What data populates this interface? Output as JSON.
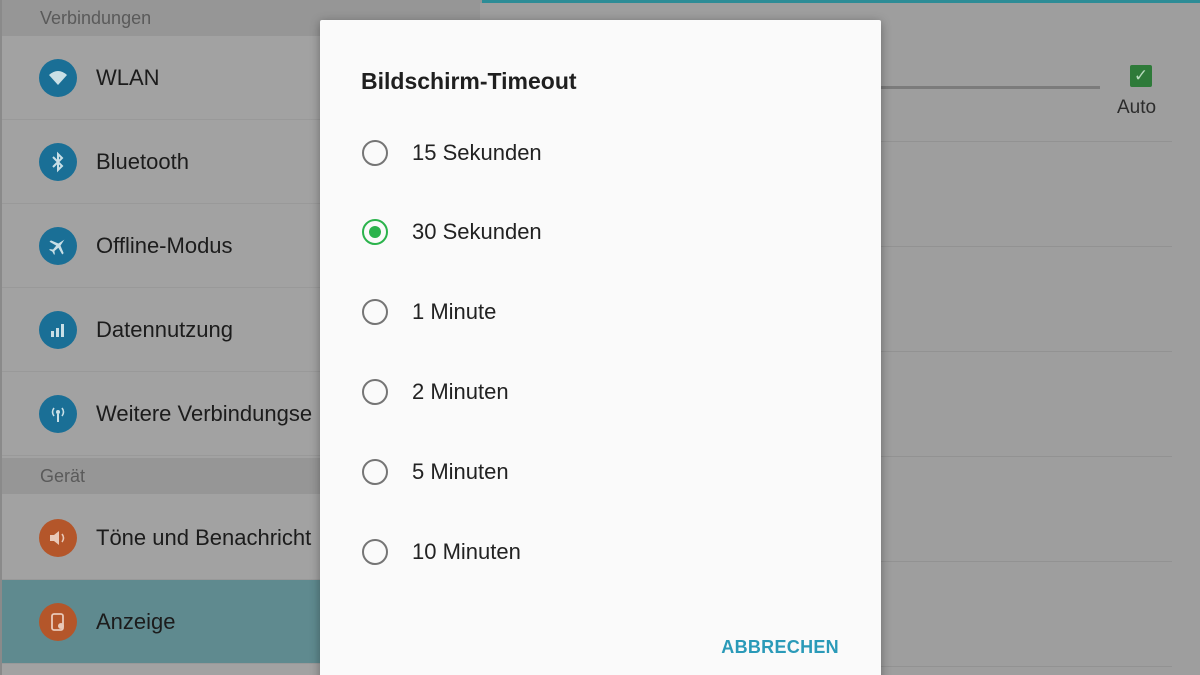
{
  "sidebar": {
    "sections": [
      {
        "label": "Verbindungen"
      },
      {
        "label": "Gerät"
      }
    ],
    "items": [
      {
        "label": "WLAN",
        "icon": "wifi-icon"
      },
      {
        "label": "Bluetooth",
        "icon": "bluetooth-icon"
      },
      {
        "label": "Offline-Modus",
        "icon": "airplane-icon"
      },
      {
        "label": "Datennutzung",
        "icon": "data-usage-icon"
      },
      {
        "label": "Weitere Verbindungse",
        "icon": "more-connections-icon"
      },
      {
        "label": "Töne und Benachricht",
        "icon": "sound-icon"
      },
      {
        "label": "Anzeige",
        "icon": "display-icon",
        "active": true
      }
    ]
  },
  "main": {
    "brightness_auto_label": "Auto",
    "brightness_auto_checked": true
  },
  "dialog": {
    "title": "Bildschirm-Timeout",
    "options": [
      {
        "label": "15 Sekunden",
        "selected": false
      },
      {
        "label": "30 Sekunden",
        "selected": true
      },
      {
        "label": "1 Minute",
        "selected": false
      },
      {
        "label": "2 Minuten",
        "selected": false
      },
      {
        "label": "5 Minuten",
        "selected": false
      },
      {
        "label": "10 Minuten",
        "selected": false
      }
    ],
    "cancel_label": "ABBRECHEN"
  },
  "colors": {
    "accent_green": "#2bb34c",
    "button_blue": "#2a9ab8",
    "icon_blue": "#1a6f96",
    "icon_orange": "#b4562a",
    "active_item": "#5f8a8f"
  }
}
